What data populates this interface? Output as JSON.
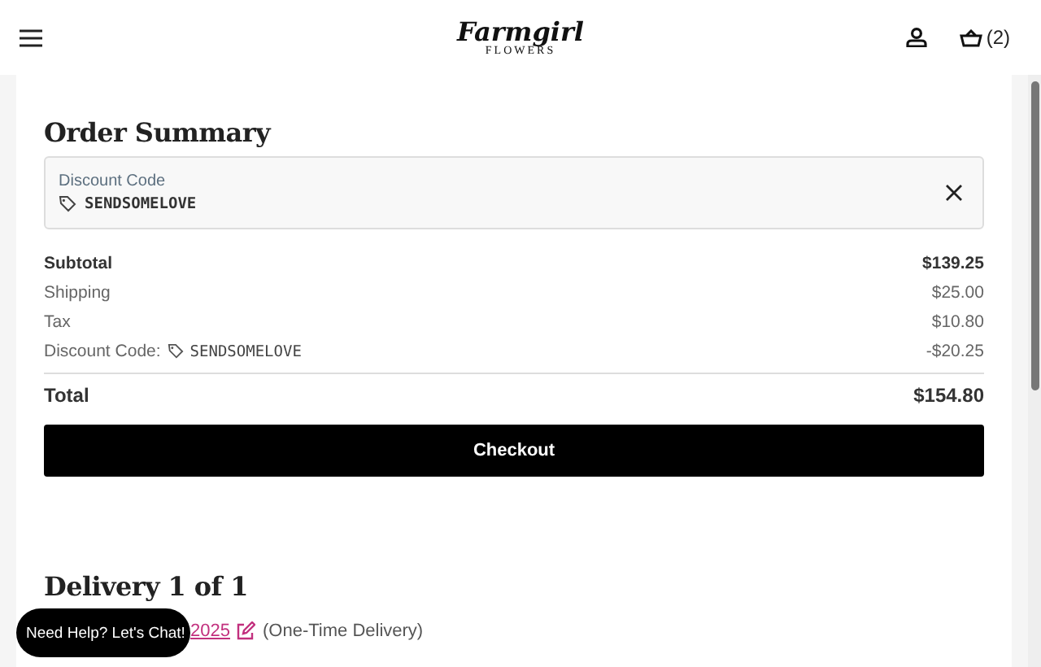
{
  "header": {
    "logo": "Farmgirl",
    "logo_sub": "FLOWERS",
    "cart_count": "(2)"
  },
  "order_summary": {
    "title": "Order Summary",
    "discount_field": {
      "label": "Discount Code",
      "value": "SENDSOMELOVE"
    },
    "lines": [
      {
        "kind": "bold",
        "label": "Subtotal",
        "amount": "$139.25"
      },
      {
        "kind": "plain",
        "label": "Shipping",
        "amount": "$25.00"
      },
      {
        "kind": "plain",
        "label": "Tax",
        "amount": "$10.80"
      },
      {
        "kind": "code",
        "label": "Discount Code:",
        "code": "SENDSOMELOVE",
        "amount": "-$20.25"
      }
    ],
    "total": {
      "label": "Total",
      "amount": "$154.80"
    },
    "checkout": "Checkout"
  },
  "delivery": {
    "title": "Delivery 1 of 1",
    "date": "2025",
    "note": "(One-Time Delivery)"
  },
  "chat_button": "Need Help? Let's Chat!"
}
